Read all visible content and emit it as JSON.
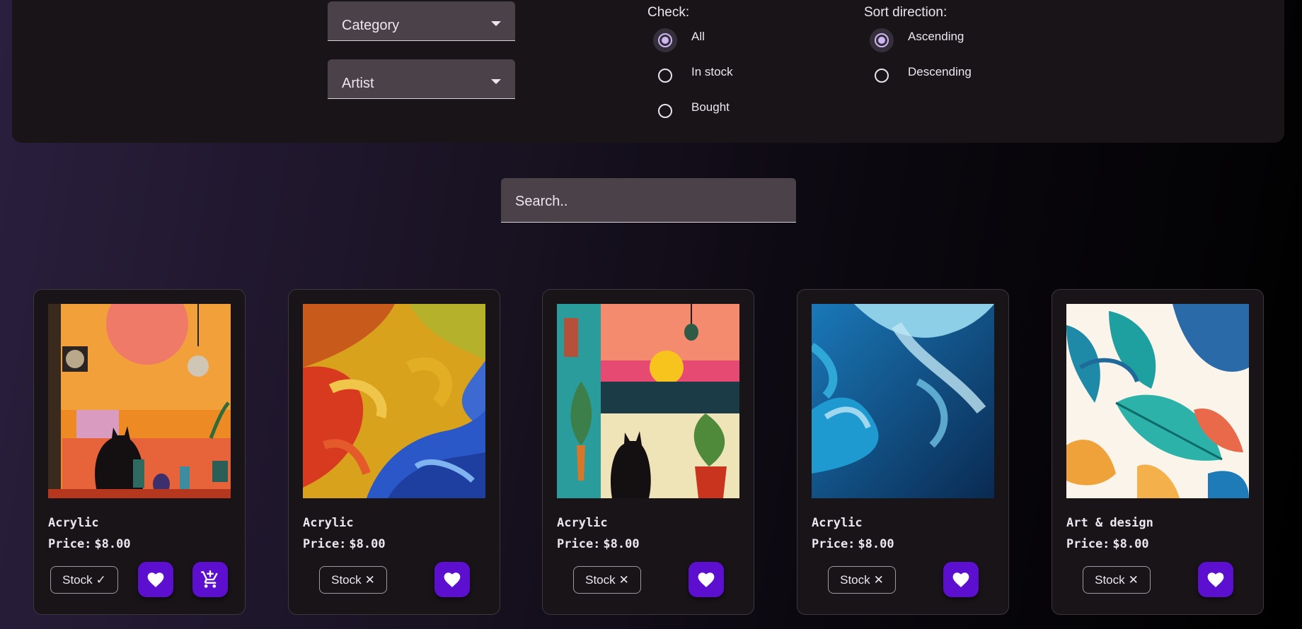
{
  "filters": {
    "category_label": "Category",
    "artist_label": "Artist",
    "check": {
      "title": "Check:",
      "options": [
        {
          "label": "All",
          "selected": true
        },
        {
          "label": "In stock",
          "selected": false
        },
        {
          "label": "Bought",
          "selected": false
        }
      ]
    },
    "sort": {
      "title": "Sort direction:",
      "options": [
        {
          "label": "Ascending",
          "selected": true
        },
        {
          "label": "Descending",
          "selected": false
        }
      ]
    }
  },
  "search": {
    "placeholder": "Search.."
  },
  "products": [
    {
      "category": "Acrylic",
      "price_label": "Price:",
      "price": "$8.00",
      "stock_label": "Stock",
      "stock_mark": "✓",
      "in_stock": true,
      "artwork": "cat-window-orange-collage"
    },
    {
      "category": "Acrylic",
      "price_label": "Price:",
      "price": "$8.00",
      "stock_label": "Stock",
      "stock_mark": "✕",
      "in_stock": false,
      "artwork": "swirled-paint-red-yellow-blue"
    },
    {
      "category": "Acrylic",
      "price_label": "Price:",
      "price": "$8.00",
      "stock_label": "Stock",
      "stock_mark": "✕",
      "in_stock": false,
      "artwork": "cat-window-sunset-plants"
    },
    {
      "category": "Acrylic",
      "price_label": "Price:",
      "price": "$8.00",
      "stock_label": "Stock",
      "stock_mark": "✕",
      "in_stock": false,
      "artwork": "blue-ocean-swirl"
    },
    {
      "category": "Art & design",
      "price_label": "Price:",
      "price": "$8.00",
      "stock_label": "Stock",
      "stock_mark": "✕",
      "in_stock": false,
      "artwork": "tropical-leaves-pattern"
    }
  ],
  "icons": {
    "favorite": "heart-icon",
    "cart": "add-to-cart-icon"
  },
  "colors": {
    "accent": "#5d0fd0",
    "radio_selected": "#cdb8f2",
    "panel": "#181418",
    "field": "#4a4149"
  }
}
